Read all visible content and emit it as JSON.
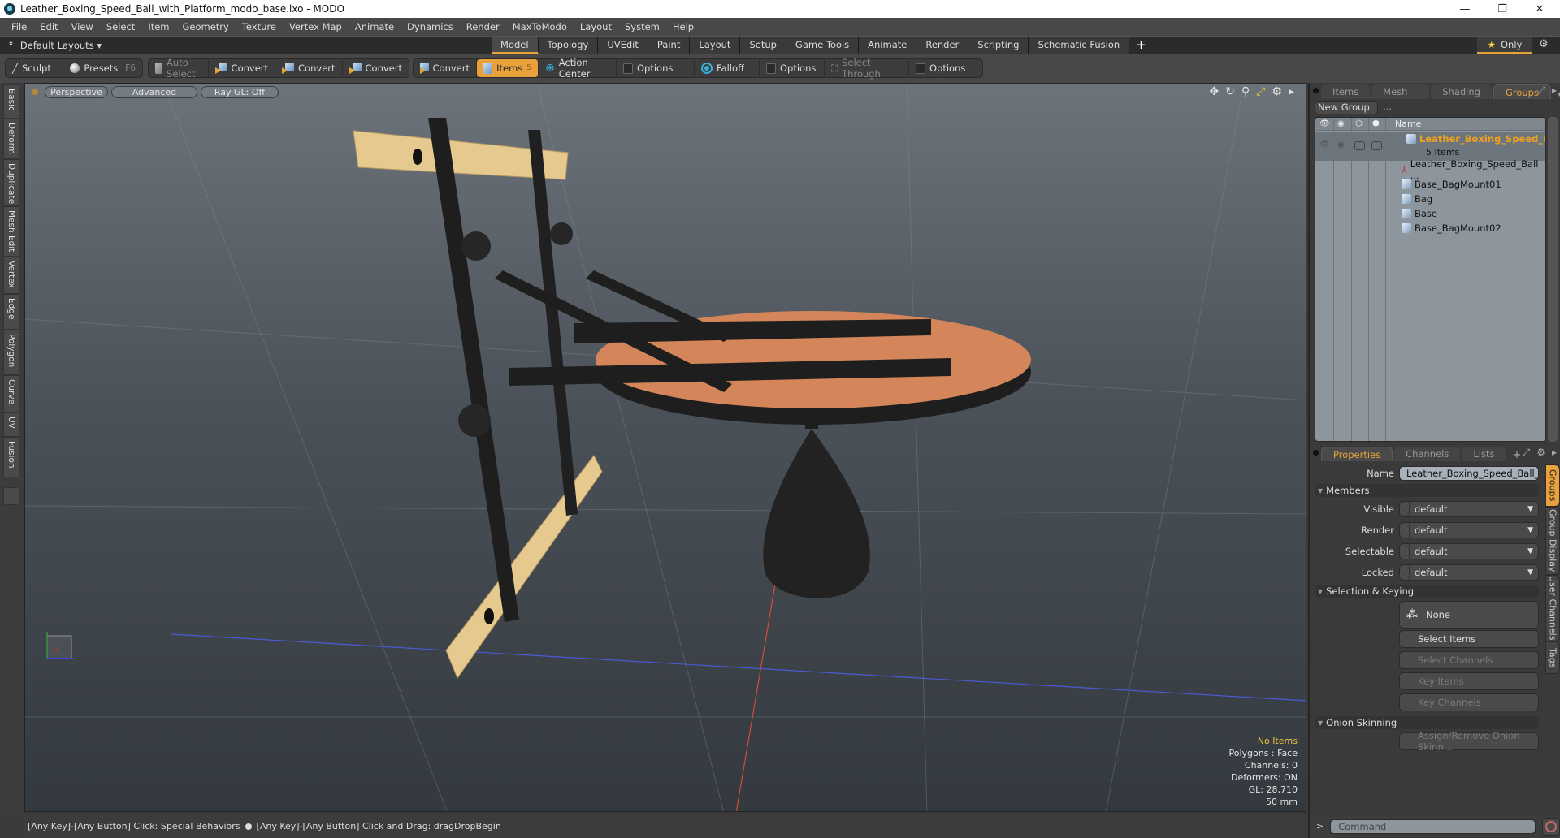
{
  "window": {
    "title": "Leather_Boxing_Speed_Ball_with_Platform_modo_base.lxo - MODO",
    "controls": {
      "minimize": "—",
      "maximize": "❐",
      "close": "✕"
    }
  },
  "menu": [
    "File",
    "Edit",
    "View",
    "Select",
    "Item",
    "Geometry",
    "Texture",
    "Vertex Map",
    "Animate",
    "Dynamics",
    "Render",
    "MaxToModo",
    "Layout",
    "System",
    "Help"
  ],
  "layout_bar": {
    "default_layouts": "Default Layouts ▾",
    "tabs": [
      "Model",
      "Topology",
      "UVEdit",
      "Paint",
      "Layout",
      "Setup",
      "Game Tools",
      "Animate",
      "Render",
      "Scripting",
      "Schematic Fusion"
    ],
    "active_tab": "Model",
    "add": "+",
    "only_label": "Only"
  },
  "toolbar": {
    "sculpt": "Sculpt",
    "presets": "Presets",
    "presets_key": "F6",
    "auto_select": "Auto Select",
    "convert_labels": [
      "Convert",
      "Convert",
      "Convert",
      "Convert"
    ],
    "items": "Items",
    "items_count": "5",
    "action_center": "Action Center",
    "options1": "Options",
    "falloff": "Falloff",
    "options2": "Options",
    "select_through": "Select Through",
    "options3": "Options"
  },
  "left_tabs": [
    "Basic",
    "Deform",
    "Duplicate",
    "Mesh Edit",
    "Vertex",
    "Edge",
    "Polygon",
    "Curve",
    "UV",
    "Fusion"
  ],
  "viewport": {
    "view_mode": "Perspective",
    "shading": "Advanced",
    "raygl": "Ray GL: Off",
    "hud": {
      "selection": "No Items",
      "polygons": "Polygons : Face",
      "channels": "Channels: 0",
      "deformers": "Deformers: ON",
      "gl": "GL: 28,710",
      "scale": "50 mm"
    },
    "colors": {
      "wood_plank": "#e6c98e",
      "platform": "#d4855a",
      "frame": "#1e1e1e",
      "bag": "#222222"
    }
  },
  "status_bar": {
    "left": "[Any Key]-[Any Button] Click: Special Behaviors",
    "right": "[Any Key]-[Any Button] Click and Drag: dragDropBegin"
  },
  "right_panel": {
    "top_tabs": [
      "Items",
      "Mesh ...",
      "Shading",
      "Groups"
    ],
    "top_active": "Groups",
    "new_group": "New Group",
    "tree_header": {
      "name": "Name"
    },
    "group": {
      "name": "Leather_Boxing_Speed_B...",
      "count": "5 Items"
    },
    "items": [
      "Leather_Boxing_Speed_Ball ...",
      "Base_BagMount01",
      "Bag",
      "Base",
      "Base_BagMount02"
    ],
    "bottom_tabs": [
      "Properties",
      "Channels",
      "Lists"
    ],
    "bottom_active": "Properties",
    "properties": {
      "name_label": "Name",
      "name_value": "Leather_Boxing_Speed_Ball_with",
      "members_section": "Members",
      "fields": [
        {
          "label": "Visible",
          "value": "default"
        },
        {
          "label": "Render",
          "value": "default"
        },
        {
          "label": "Selectable",
          "value": "default"
        },
        {
          "label": "Locked",
          "value": "default"
        }
      ],
      "selection_section": "Selection & Keying",
      "none_label": "None",
      "select_items": "Select Items",
      "select_channels": "Select Channels",
      "key_items": "Key Items",
      "key_channels": "Key Channels",
      "onion_section": "Onion Skinning",
      "assign_onion": "Assign/Remove Onion Skinn..."
    },
    "side_tabs": [
      "Groups",
      "Group Display",
      "User Channels",
      "Tags"
    ],
    "side_active": "Groups",
    "command_placeholder": "Command",
    "command_prompt": ">"
  }
}
